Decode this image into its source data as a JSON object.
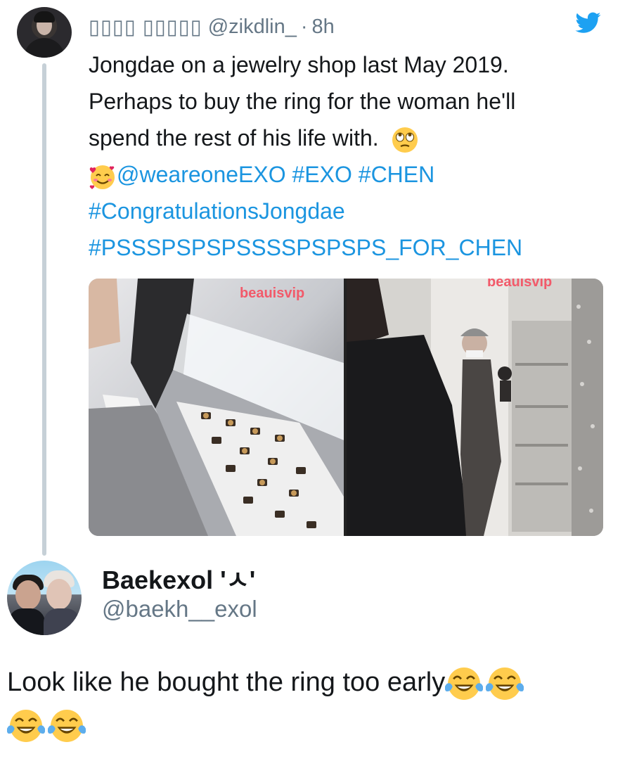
{
  "tweet": {
    "author_name": "▯▯▯▯ ▯▯▯▯▯",
    "handle": "@zikdlin_",
    "separator": "·",
    "timestamp": "8h",
    "text_line1": "Jongdae on a jewelry shop last May 2019.",
    "text_line2": "Perhaps to buy the ring for the woman he'll",
    "text_line3": "spend the rest of his life with.",
    "mention": "@weareoneEXO",
    "hashtag_exo": "#EXO",
    "hashtag_chen": "#CHEN",
    "hashtag_congrats": "#CongratulationsJongdae",
    "hashtag_pssps": "#PSSSPSPSPSSSSPSPSPS_FOR_CHEN",
    "media": {
      "watermark_left": "beauisvip",
      "watermark_right": "beauisvip"
    }
  },
  "quoted": {
    "name": "Baekexol 'ㅅ'",
    "handle": "@baekh__exol",
    "reply_line1": "Look like he bought the ring too early",
    "emoji_name": "face-with-tears-of-joy"
  },
  "colors": {
    "link": "#1b95e0",
    "muted": "#657786",
    "twitter_blue": "#1da1f2"
  }
}
